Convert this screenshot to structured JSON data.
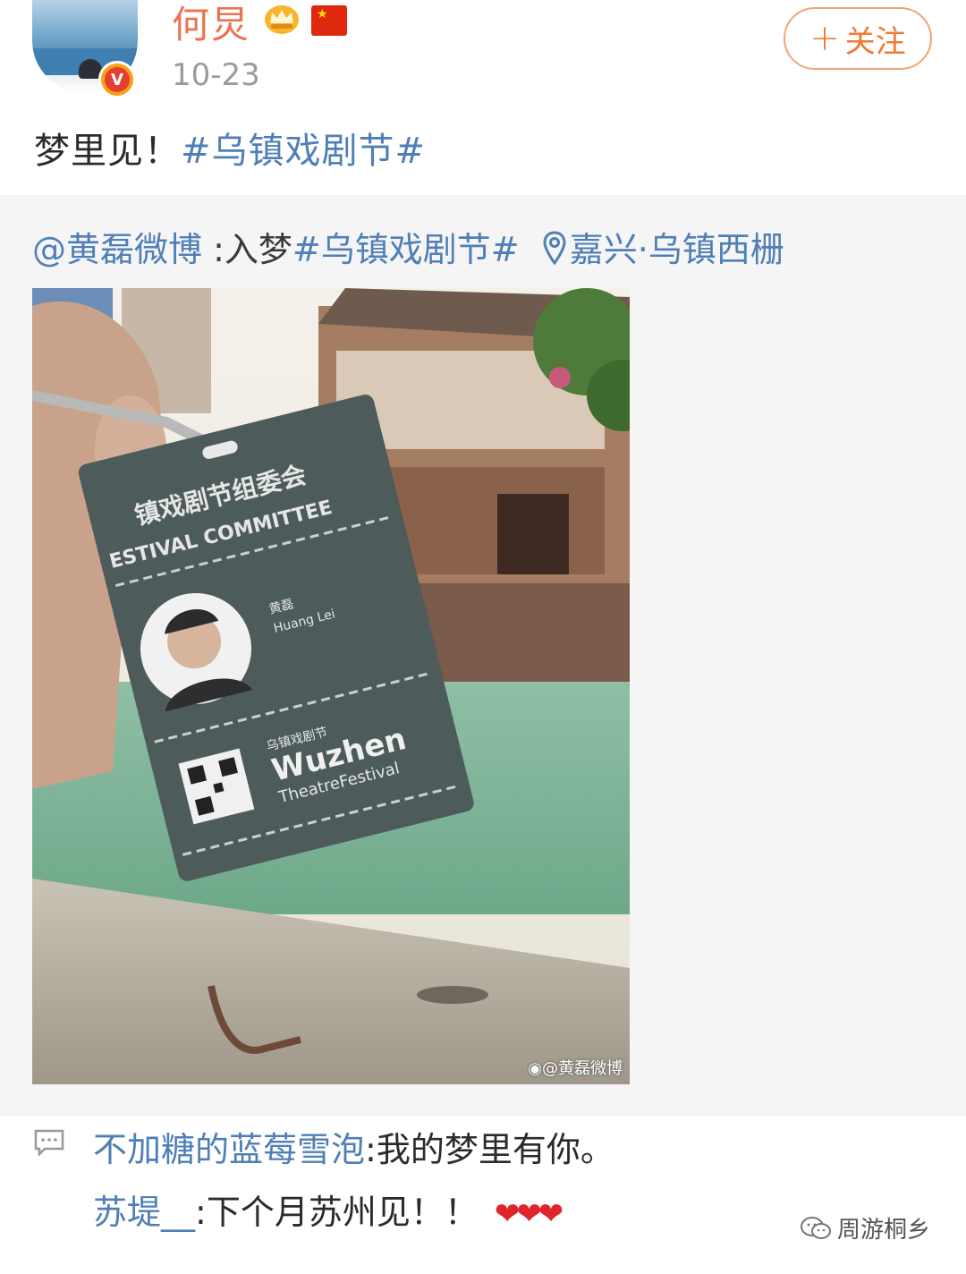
{
  "post": {
    "author": "何炅",
    "date": "10-23",
    "follow_label": "关注",
    "text_plain": "梦里见！",
    "text_tag": "#乌镇戏剧节#",
    "verified_mark": "V"
  },
  "repost": {
    "mention": "@黄磊微博",
    "content": " :入梦",
    "tag": "#乌镇戏剧节#",
    "location": "嘉兴·乌镇西栅",
    "location_icon": "location-pin-icon",
    "image_watermark": "@黄磊微博",
    "badge": {
      "org_title": "镇戏剧节组委会",
      "org_title_en": "ESTIVAL COMMITTEE",
      "person_cn": "黄磊",
      "person_en": "Huang Lei",
      "brand_cn": "乌镇戏剧节",
      "brand_main": "Wuzhen",
      "brand_sub": "TheatreFestival"
    }
  },
  "comments": [
    {
      "user": "不加糖的蓝莓雪泡",
      "text": ":我的梦里有你。"
    },
    {
      "user": "苏堤__",
      "text": ":下个月苏州见！！",
      "suffix": "❤❤❤"
    }
  ],
  "footer": {
    "wechat_account": "周游桐乡"
  },
  "colors": {
    "link": "#4f7fb6",
    "name": "#eb7350",
    "follow": "#ee7a36"
  }
}
